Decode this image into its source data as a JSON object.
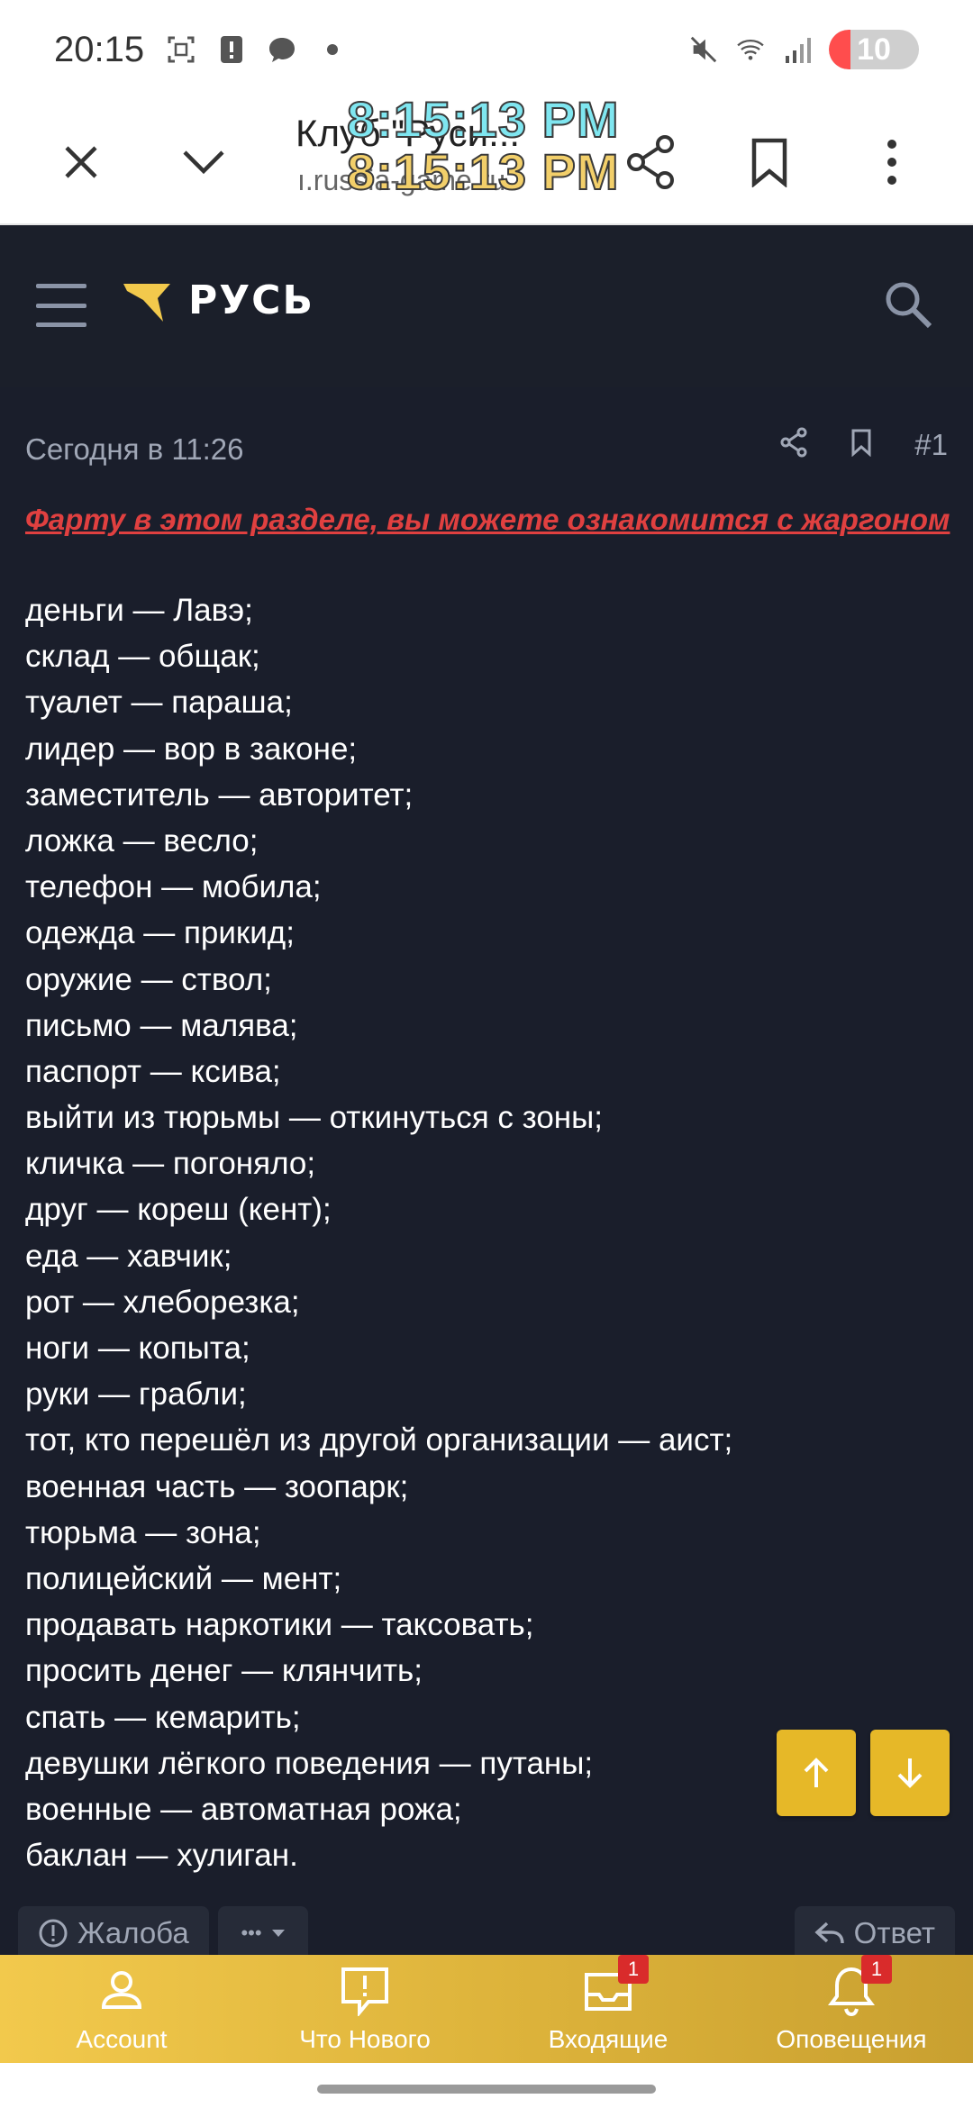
{
  "status_bar": {
    "time": "20:15",
    "battery": "10"
  },
  "browser": {
    "title": "Клуб \"Руси...",
    "url": "ı.russia-game.ru",
    "clock_overlay_1": "8:15:13 PM",
    "clock_overlay_2": "8:15:13 PM"
  },
  "site": {
    "logo_text": "РУСЬ"
  },
  "post": {
    "date": "Сегодня в 11:26",
    "number": "#1",
    "headline": "Фарту в этом разделе, вы можете ознакомится с жаргоном",
    "lines": [
      "деньги — Лавэ;",
      "склад — общак;",
      "туалет — параша;",
      "лидер — вор в законе;",
      "заместитель — авторитет;",
      "ложка — весло;",
      "телефон — мобила;",
      "одежда — прикид;",
      "оружие — ствол;",
      "письмо — малява;",
      "паспорт — ксива;",
      "выйти из тюрьмы — откинуться с зоны;",
      "кличка — погоняло;",
      "друг — кореш (кент);",
      "еда — хавчик;",
      "рот — хлеборезка;",
      "ноги — копыта;",
      "руки — грабли;",
      "тот, кто перешёл из другой организации — аист;",
      "военная часть — зоопарк;",
      "тюрьма — зона;",
      "полицейский — мент;",
      "продавать наркотики — таксовать;",
      "просить денег — клянчить;",
      "спать — кемарить;",
      "девушки лёгкого поведения — путаны;",
      "военные — автоматная рожа;",
      "баклан — хулиган."
    ],
    "actions": {
      "report": "Жалоба",
      "more": "•••",
      "reply": "Ответ"
    }
  },
  "bottom_nav": {
    "items": [
      {
        "label": "Account",
        "icon": "account-icon",
        "badge": ""
      },
      {
        "label": "Что Нового",
        "icon": "whats-new-icon",
        "badge": ""
      },
      {
        "label": "Входящие",
        "icon": "inbox-icon",
        "badge": "1"
      },
      {
        "label": "Оповещения",
        "icon": "bell-icon",
        "badge": "1"
      }
    ]
  },
  "colors": {
    "accent": "#e6b828",
    "content_bg": "#1a1e2b",
    "headline": "#e04040"
  }
}
